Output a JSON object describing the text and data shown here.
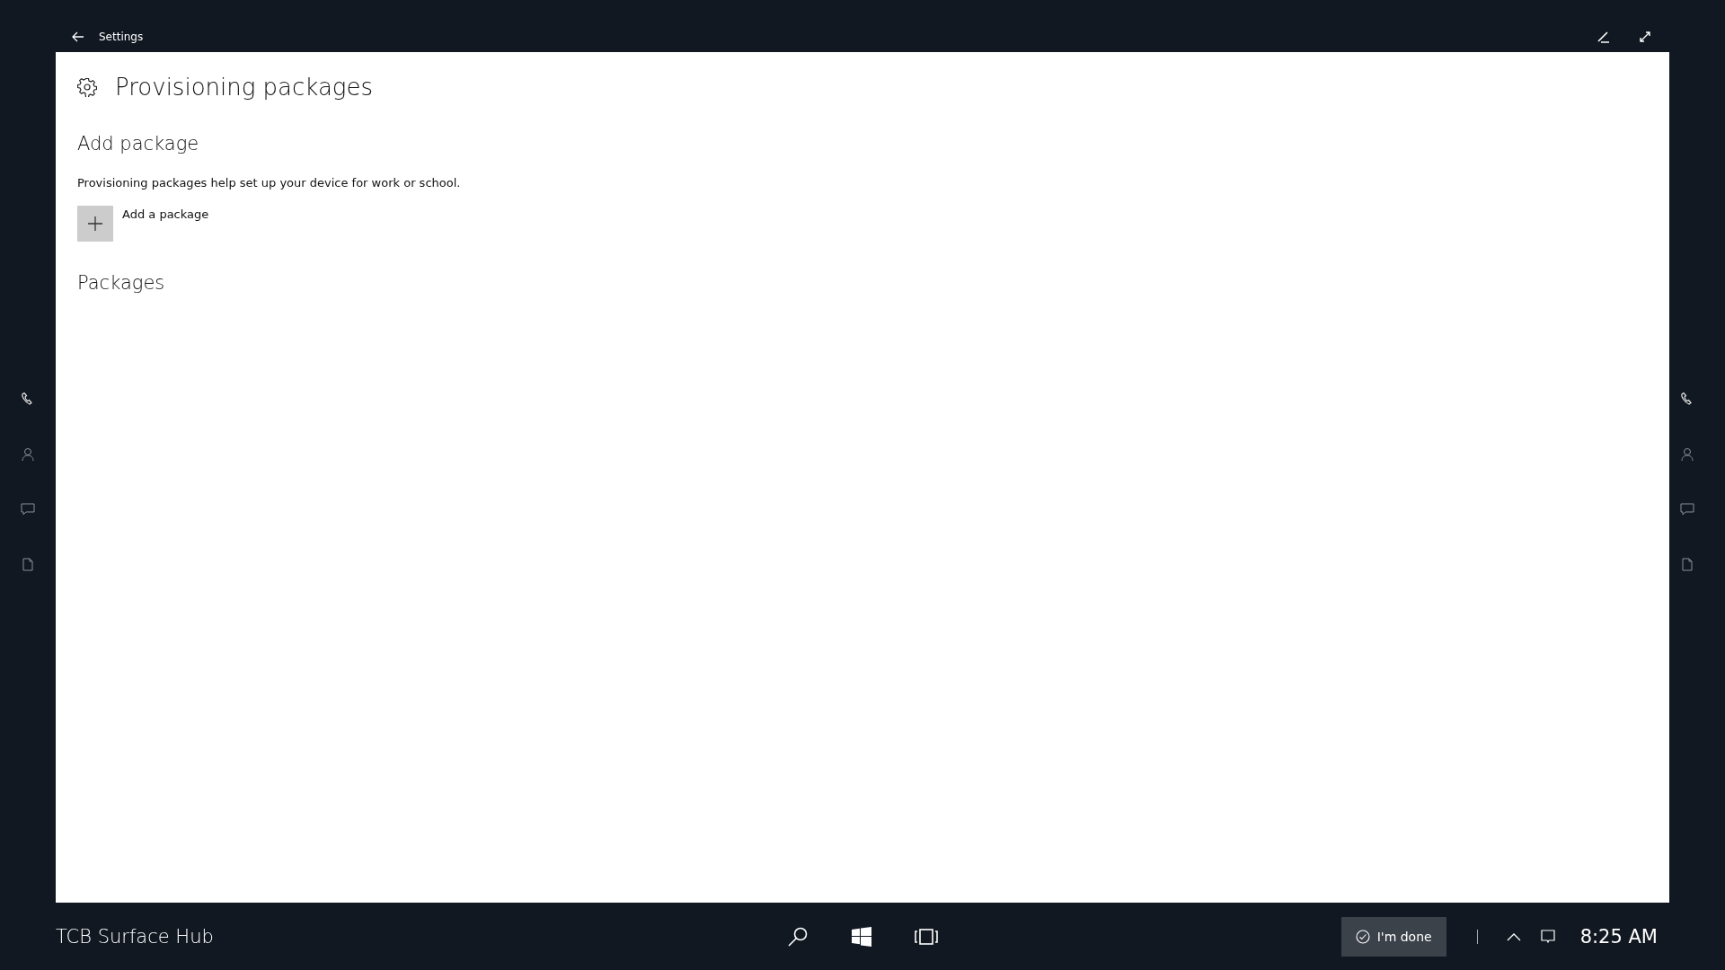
{
  "window": {
    "title": "Settings"
  },
  "page": {
    "title": "Provisioning packages"
  },
  "add_section": {
    "heading": "Add package",
    "description": "Provisioning packages help set up your device for work or school.",
    "add_button": "Add a package"
  },
  "packages_section": {
    "heading": "Packages"
  },
  "taskbar": {
    "device_name": "TCB Surface Hub",
    "done_button": "I'm done",
    "time": "8:25 AM"
  }
}
